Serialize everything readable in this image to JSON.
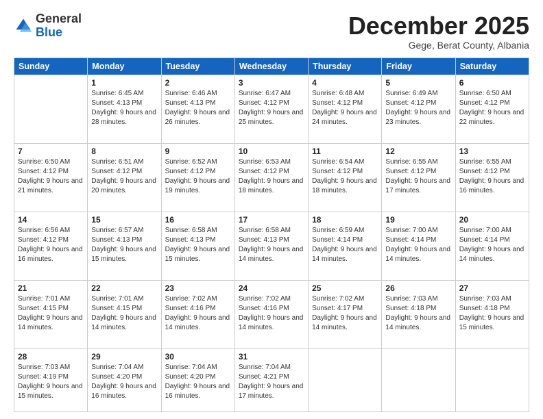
{
  "logo": {
    "general": "General",
    "blue": "Blue"
  },
  "header": {
    "month": "December 2025",
    "location": "Gege, Berat County, Albania"
  },
  "weekdays": [
    "Sunday",
    "Monday",
    "Tuesday",
    "Wednesday",
    "Thursday",
    "Friday",
    "Saturday"
  ],
  "weeks": [
    [
      {
        "day": "",
        "sunrise": "",
        "sunset": "",
        "daylight": "",
        "empty": true
      },
      {
        "day": "1",
        "sunrise": "Sunrise: 6:45 AM",
        "sunset": "Sunset: 4:13 PM",
        "daylight": "Daylight: 9 hours and 28 minutes."
      },
      {
        "day": "2",
        "sunrise": "Sunrise: 6:46 AM",
        "sunset": "Sunset: 4:13 PM",
        "daylight": "Daylight: 9 hours and 26 minutes."
      },
      {
        "day": "3",
        "sunrise": "Sunrise: 6:47 AM",
        "sunset": "Sunset: 4:12 PM",
        "daylight": "Daylight: 9 hours and 25 minutes."
      },
      {
        "day": "4",
        "sunrise": "Sunrise: 6:48 AM",
        "sunset": "Sunset: 4:12 PM",
        "daylight": "Daylight: 9 hours and 24 minutes."
      },
      {
        "day": "5",
        "sunrise": "Sunrise: 6:49 AM",
        "sunset": "Sunset: 4:12 PM",
        "daylight": "Daylight: 9 hours and 23 minutes."
      },
      {
        "day": "6",
        "sunrise": "Sunrise: 6:50 AM",
        "sunset": "Sunset: 4:12 PM",
        "daylight": "Daylight: 9 hours and 22 minutes."
      }
    ],
    [
      {
        "day": "7",
        "sunrise": "Sunrise: 6:50 AM",
        "sunset": "Sunset: 4:12 PM",
        "daylight": "Daylight: 9 hours and 21 minutes."
      },
      {
        "day": "8",
        "sunrise": "Sunrise: 6:51 AM",
        "sunset": "Sunset: 4:12 PM",
        "daylight": "Daylight: 9 hours and 20 minutes."
      },
      {
        "day": "9",
        "sunrise": "Sunrise: 6:52 AM",
        "sunset": "Sunset: 4:12 PM",
        "daylight": "Daylight: 9 hours and 19 minutes."
      },
      {
        "day": "10",
        "sunrise": "Sunrise: 6:53 AM",
        "sunset": "Sunset: 4:12 PM",
        "daylight": "Daylight: 9 hours and 18 minutes."
      },
      {
        "day": "11",
        "sunrise": "Sunrise: 6:54 AM",
        "sunset": "Sunset: 4:12 PM",
        "daylight": "Daylight: 9 hours and 18 minutes."
      },
      {
        "day": "12",
        "sunrise": "Sunrise: 6:55 AM",
        "sunset": "Sunset: 4:12 PM",
        "daylight": "Daylight: 9 hours and 17 minutes."
      },
      {
        "day": "13",
        "sunrise": "Sunrise: 6:55 AM",
        "sunset": "Sunset: 4:12 PM",
        "daylight": "Daylight: 9 hours and 16 minutes."
      }
    ],
    [
      {
        "day": "14",
        "sunrise": "Sunrise: 6:56 AM",
        "sunset": "Sunset: 4:12 PM",
        "daylight": "Daylight: 9 hours and 16 minutes."
      },
      {
        "day": "15",
        "sunrise": "Sunrise: 6:57 AM",
        "sunset": "Sunset: 4:13 PM",
        "daylight": "Daylight: 9 hours and 15 minutes."
      },
      {
        "day": "16",
        "sunrise": "Sunrise: 6:58 AM",
        "sunset": "Sunset: 4:13 PM",
        "daylight": "Daylight: 9 hours and 15 minutes."
      },
      {
        "day": "17",
        "sunrise": "Sunrise: 6:58 AM",
        "sunset": "Sunset: 4:13 PM",
        "daylight": "Daylight: 9 hours and 14 minutes."
      },
      {
        "day": "18",
        "sunrise": "Sunrise: 6:59 AM",
        "sunset": "Sunset: 4:14 PM",
        "daylight": "Daylight: 9 hours and 14 minutes."
      },
      {
        "day": "19",
        "sunrise": "Sunrise: 7:00 AM",
        "sunset": "Sunset: 4:14 PM",
        "daylight": "Daylight: 9 hours and 14 minutes."
      },
      {
        "day": "20",
        "sunrise": "Sunrise: 7:00 AM",
        "sunset": "Sunset: 4:14 PM",
        "daylight": "Daylight: 9 hours and 14 minutes."
      }
    ],
    [
      {
        "day": "21",
        "sunrise": "Sunrise: 7:01 AM",
        "sunset": "Sunset: 4:15 PM",
        "daylight": "Daylight: 9 hours and 14 minutes."
      },
      {
        "day": "22",
        "sunrise": "Sunrise: 7:01 AM",
        "sunset": "Sunset: 4:15 PM",
        "daylight": "Daylight: 9 hours and 14 minutes."
      },
      {
        "day": "23",
        "sunrise": "Sunrise: 7:02 AM",
        "sunset": "Sunset: 4:16 PM",
        "daylight": "Daylight: 9 hours and 14 minutes."
      },
      {
        "day": "24",
        "sunrise": "Sunrise: 7:02 AM",
        "sunset": "Sunset: 4:16 PM",
        "daylight": "Daylight: 9 hours and 14 minutes."
      },
      {
        "day": "25",
        "sunrise": "Sunrise: 7:02 AM",
        "sunset": "Sunset: 4:17 PM",
        "daylight": "Daylight: 9 hours and 14 minutes."
      },
      {
        "day": "26",
        "sunrise": "Sunrise: 7:03 AM",
        "sunset": "Sunset: 4:18 PM",
        "daylight": "Daylight: 9 hours and 14 minutes."
      },
      {
        "day": "27",
        "sunrise": "Sunrise: 7:03 AM",
        "sunset": "Sunset: 4:18 PM",
        "daylight": "Daylight: 9 hours and 15 minutes."
      }
    ],
    [
      {
        "day": "28",
        "sunrise": "Sunrise: 7:03 AM",
        "sunset": "Sunset: 4:19 PM",
        "daylight": "Daylight: 9 hours and 15 minutes."
      },
      {
        "day": "29",
        "sunrise": "Sunrise: 7:04 AM",
        "sunset": "Sunset: 4:20 PM",
        "daylight": "Daylight: 9 hours and 16 minutes."
      },
      {
        "day": "30",
        "sunrise": "Sunrise: 7:04 AM",
        "sunset": "Sunset: 4:20 PM",
        "daylight": "Daylight: 9 hours and 16 minutes."
      },
      {
        "day": "31",
        "sunrise": "Sunrise: 7:04 AM",
        "sunset": "Sunset: 4:21 PM",
        "daylight": "Daylight: 9 hours and 17 minutes."
      },
      {
        "day": "",
        "sunrise": "",
        "sunset": "",
        "daylight": "",
        "empty": true
      },
      {
        "day": "",
        "sunrise": "",
        "sunset": "",
        "daylight": "",
        "empty": true
      },
      {
        "day": "",
        "sunrise": "",
        "sunset": "",
        "daylight": "",
        "empty": true
      }
    ]
  ]
}
